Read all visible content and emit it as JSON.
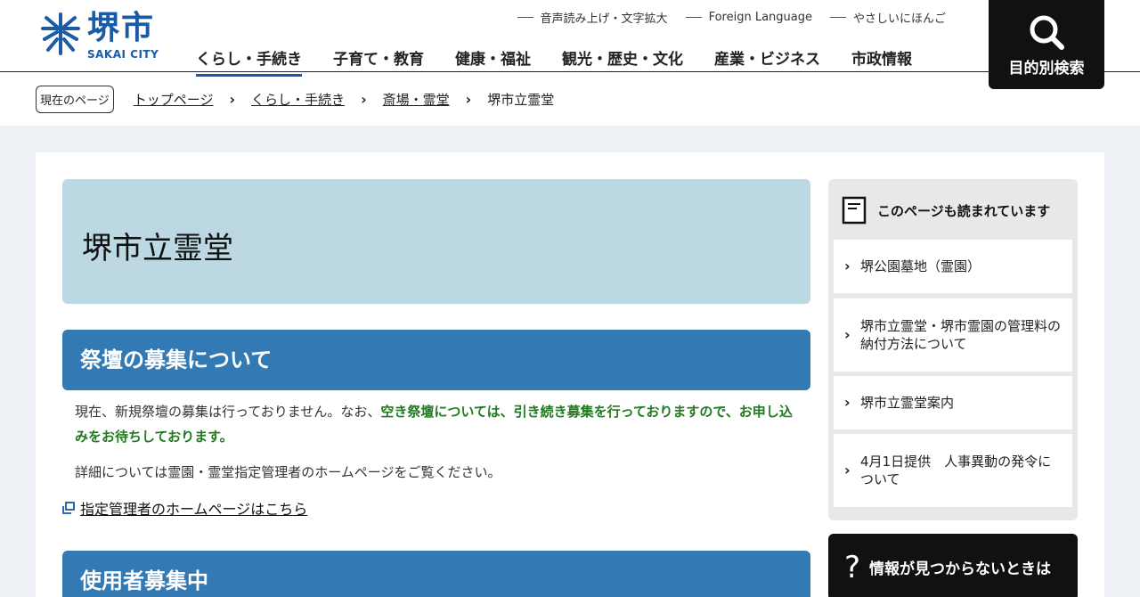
{
  "header": {
    "logo_kanji": "堺市",
    "logo_roman": "SAKAI CITY",
    "util_links": [
      "音声読み上げ・文字拡大",
      "Foreign Language",
      "やさしいにほんご"
    ],
    "nav": [
      "くらし・手続き",
      "子育て・教育",
      "健康・福祉",
      "観光・歴史・文化",
      "産業・ビジネス",
      "市政情報"
    ],
    "search_label": "目的別検索"
  },
  "breadcrumb": {
    "badge": "現在のページ",
    "items": [
      "トップページ",
      "くらし・手続き",
      "斎場・霊堂"
    ],
    "current": "堺市立霊堂"
  },
  "main": {
    "title": "堺市立霊堂",
    "section1": {
      "heading": "祭壇の募集について",
      "p1_plain": "現在、新規祭壇の募集は行っておりません。なお、",
      "p1_highlight": "空き祭壇については、引き続き募集を行っておりますので、お申し込みをお待ちしております。",
      "p2": "詳細については霊園・霊堂指定管理者のホームページをご覧ください。",
      "link": "指定管理者のホームページはこちら"
    },
    "section2": {
      "heading": "使用者募集中"
    }
  },
  "sidebar": {
    "heading": "このページも読まれています",
    "items": [
      "堺公園墓地（霊園）",
      "堺市立霊堂・堺市霊園の管理料の納付方法について",
      "堺市立霊堂案内",
      "4月1日提供　人事異動の発令について"
    ],
    "help": "情報が見つからないときは"
  },
  "colors": {
    "brand_blue": "#1a5aa6",
    "section_blue": "#3379b4",
    "title_bg": "#bcd8e2",
    "highlight_green": "#217a1f"
  }
}
